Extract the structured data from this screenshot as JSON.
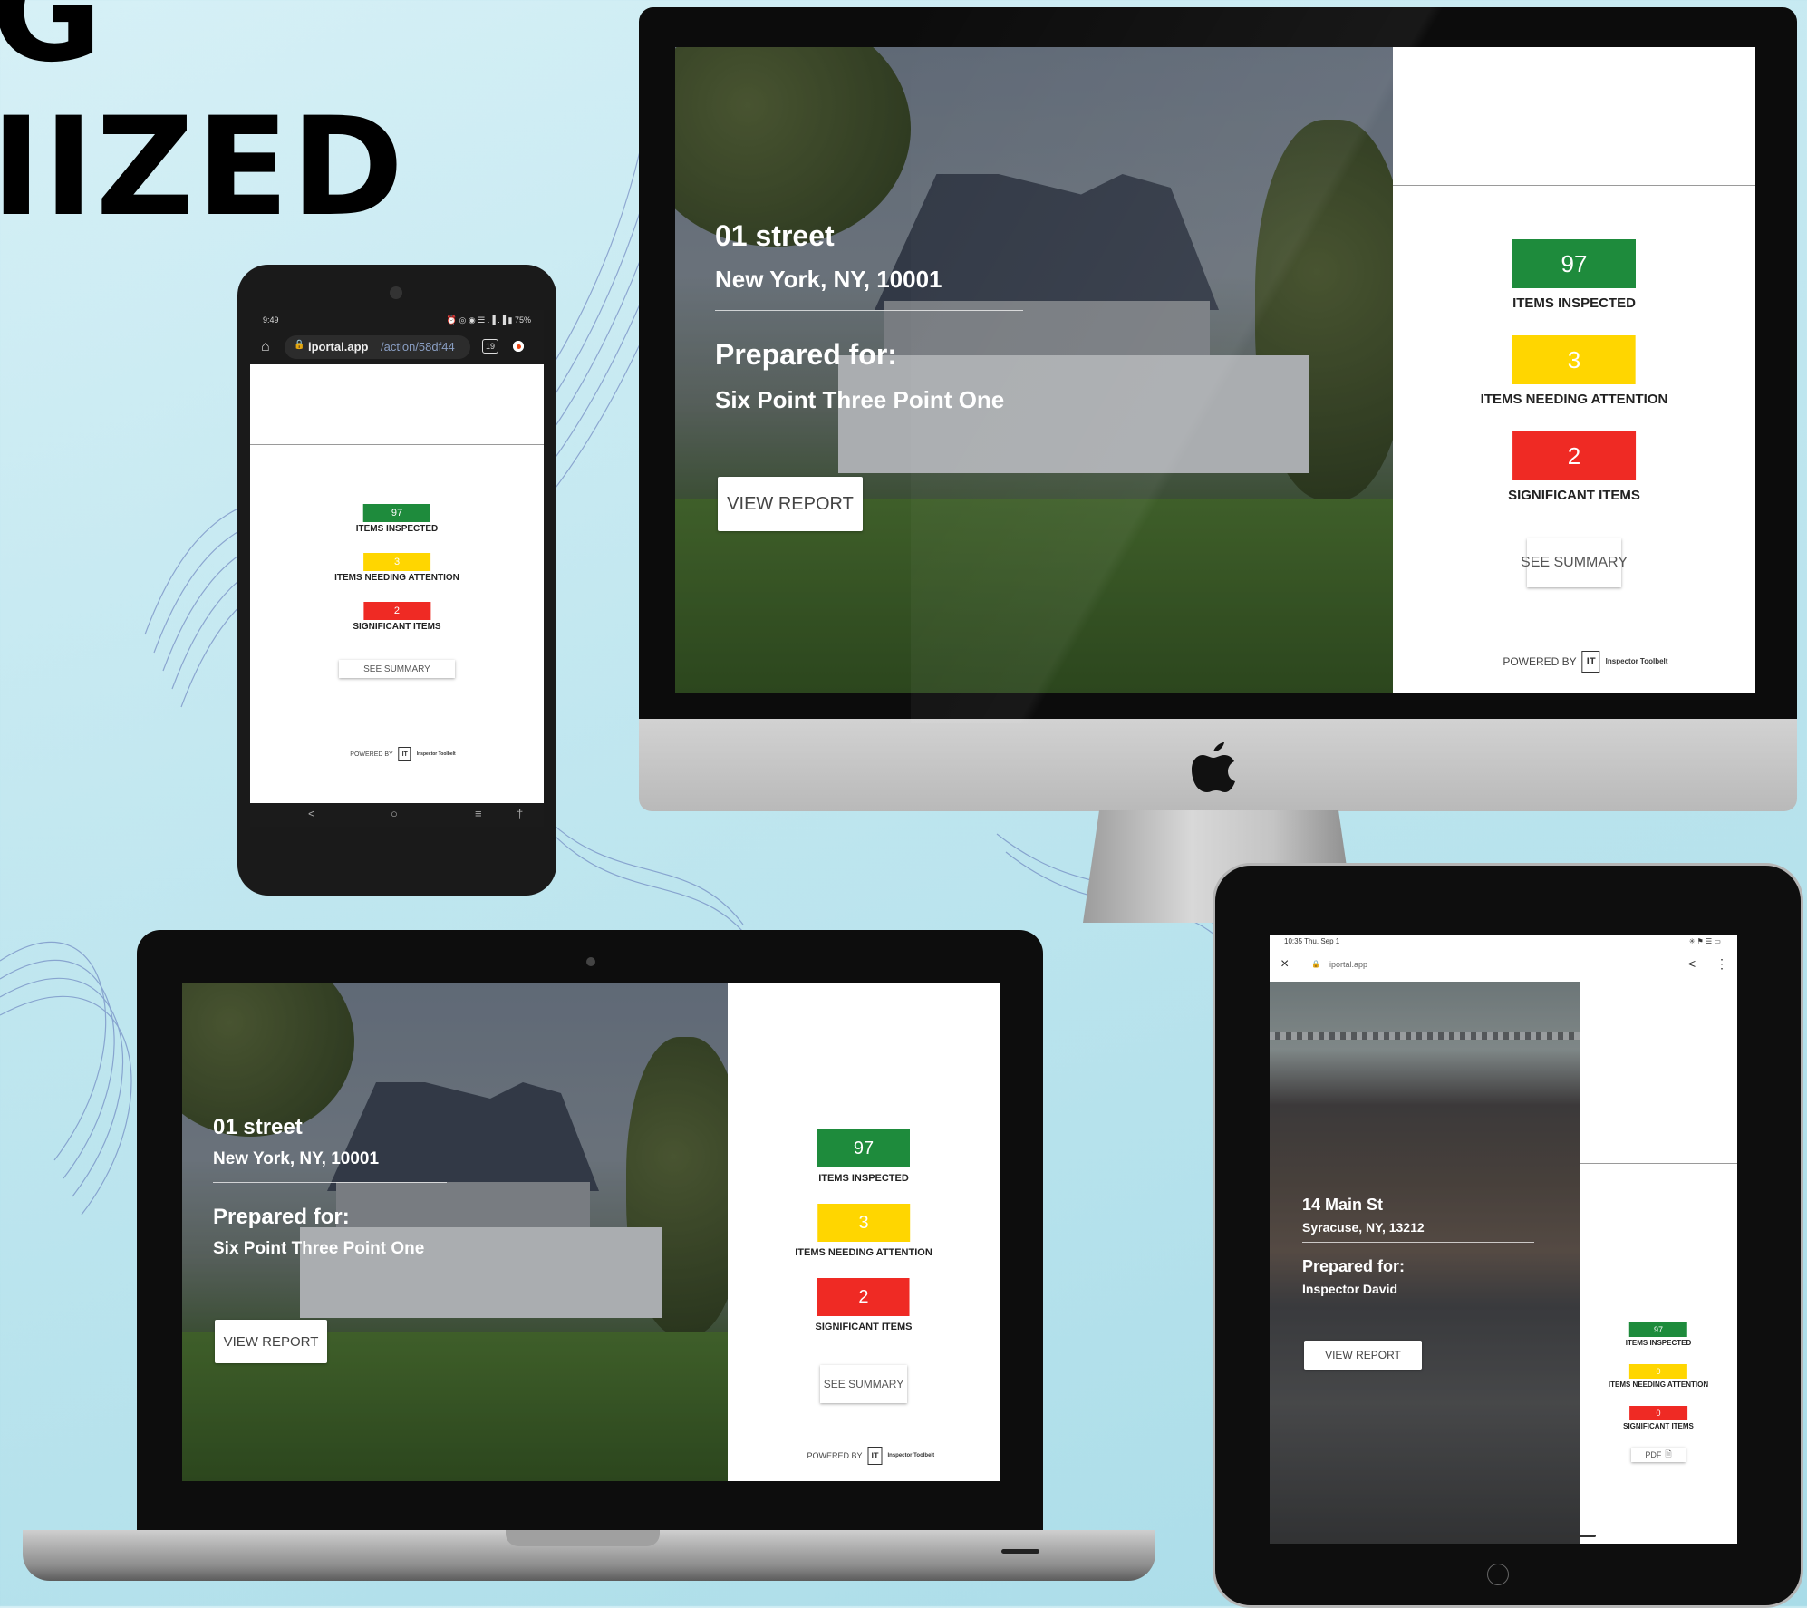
{
  "headline": {
    "line1": "G",
    "line2": "IIZED"
  },
  "report": {
    "street": "01 street",
    "city": "New York, NY, 10001",
    "prepared_label": "Prepared for:",
    "client": "Six Point Three Point One",
    "view_report": "VIEW REPORT",
    "stats": [
      {
        "value": "97",
        "label": "ITEMS INSPECTED",
        "color": "#1e8b3c"
      },
      {
        "value": "3",
        "label": "ITEMS NEEDING ATTENTION",
        "color": "#ffd600"
      },
      {
        "value": "2",
        "label": "SIGNIFICANT ITEMS",
        "color": "#ef2a24"
      }
    ],
    "see_summary": "SEE SUMMARY",
    "powered_by": "POWERED BY",
    "logo_letters": "IT",
    "logo_name": "Inspector Toolbelt"
  },
  "phone": {
    "time": "9:49",
    "status_icons": "⏰ ◎ ◉ ☰ .▐ .▐ ▮ 75%",
    "url_host": "iportal.app",
    "url_path": "/action/58df44",
    "tab_count": "19"
  },
  "tablet": {
    "time_date": "10:35  Thu, Sep 1",
    "status_icons": "✳ ⚑ ☰ ▭",
    "url": "iportal.app",
    "street": "14 Main St",
    "city": "Syracuse, NY, 13212",
    "prepared_label": "Prepared for:",
    "client": "Inspector David",
    "view_report": "VIEW REPORT",
    "stats": [
      {
        "value": "97",
        "label": "ITEMS INSPECTED"
      },
      {
        "value": "0",
        "label": "ITEMS NEEDING ATTENTION"
      },
      {
        "value": "0",
        "label": "SIGNIFICANT ITEMS"
      }
    ],
    "pdf": "PDF"
  },
  "icons": {
    "apple": "apple-logo-icon",
    "home": "home-icon",
    "lock": "lock-icon",
    "close": "close-icon",
    "share": "share-icon",
    "menu": "more-vert-icon"
  }
}
